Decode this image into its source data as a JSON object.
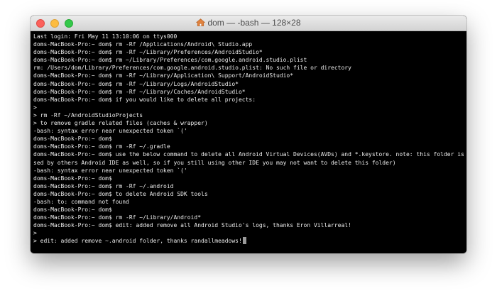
{
  "window": {
    "title": "dom — -bash — 128×28",
    "title_icon": "home-icon"
  },
  "colors": {
    "terminal_background": "#000000",
    "terminal_text": "#ececec",
    "close": "#fc605b",
    "minimize": "#fdbc40",
    "zoom": "#34c84a"
  },
  "terminal": {
    "lines": [
      "Last login: Fri May 11 13:10:06 on ttys000",
      "doms-MacBook-Pro:~ dom$ rm -Rf /Applications/Android\\ Studio.app",
      "doms-MacBook-Pro:~ dom$ rm -Rf ~/Library/Preferences/AndroidStudio*",
      "doms-MacBook-Pro:~ dom$ rm ~/Library/Preferences/com.google.android.studio.plist",
      "rm: /Users/dom/Library/Preferences/com.google.android.studio.plist: No such file or directory",
      "doms-MacBook-Pro:~ dom$ rm -Rf ~/Library/Application\\ Support/AndroidStudio*",
      "doms-MacBook-Pro:~ dom$ rm -Rf ~/Library/Logs/AndroidStudio*",
      "doms-MacBook-Pro:~ dom$ rm -Rf ~/Library/Caches/AndroidStudio*",
      "doms-MacBook-Pro:~ dom$ if you would like to delete all projects:",
      ">",
      "> rm -Rf ~/AndroidStudioProjects",
      "> to remove gradle related files (caches & wrapper)",
      "-bash: syntax error near unexpected token `('",
      "doms-MacBook-Pro:~ dom$",
      "doms-MacBook-Pro:~ dom$ rm -Rf ~/.gradle",
      "doms-MacBook-Pro:~ dom$ use the below command to delete all Android Virtual Devices(AVDs) and *.keystore. note: this folder is u",
      "sed by others Android IDE as well, so if you still using other IDE you may not want to delete this folder)",
      "-bash: syntax error near unexpected token `('",
      "doms-MacBook-Pro:~ dom$",
      "doms-MacBook-Pro:~ dom$ rm -Rf ~/.android",
      "doms-MacBook-Pro:~ dom$ to delete Android SDK tools",
      "-bash: to: command not found",
      "doms-MacBook-Pro:~ dom$",
      "doms-MacBook-Pro:~ dom$ rm -Rf ~/Library/Android*",
      "doms-MacBook-Pro:~ dom$ edit: added remove all Android Studio's logs, thanks Eron Villarreal!",
      ">",
      "> edit: added remove ~.android folder, thanks randallmeadows!"
    ]
  }
}
